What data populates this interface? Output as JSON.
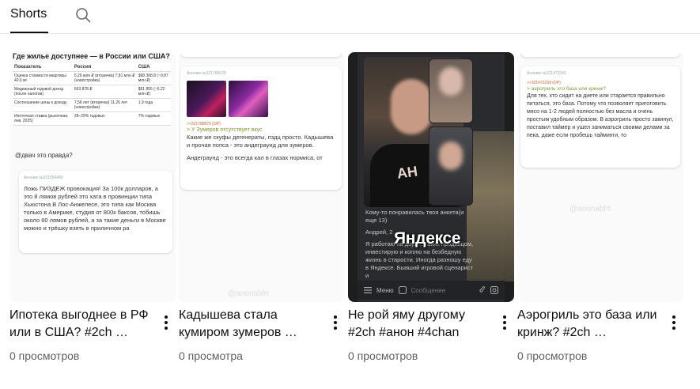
{
  "tabs": {
    "shorts_label": "Shorts"
  },
  "videos": [
    {
      "title": "Ипотека выгоднее в РФ или в США? #2ch …",
      "views": "0 просмотров",
      "thumb": {
        "heading": "Где жилье доступнее — в России или США?",
        "table_head": [
          "Показатель",
          "Россия",
          "США"
        ],
        "rows": [
          [
            "Оценка стоимости квартиры 40,6 м²",
            "5,26 млн ₽ (вторичка) 7,81 млн ₽ (новостройка)",
            "$98 368,8 (~9,87 млн ₽)"
          ],
          [
            "Медианный годовой доход (после налогов)",
            "693 878 ₽",
            "$51 855 (~5,22 млн ₽)"
          ],
          [
            "Соотношение цены к доходу",
            "7,58 лет (вторичка) 11,26 лет (новостройка)",
            "1,9 года"
          ],
          [
            "Ипотечная ставка (рыночная, янв. 2025)",
            "28–29% годовых",
            "7% годовых"
          ]
        ],
        "question": "@двач это правда?",
        "anon": "Аноним   №321856489",
        "post": "Ложь ПИЗДЕЖ провокация! За 100к долларов, а это 8 лямов рублей это хата в провинции типа Хьюстона В Лос-Анжелесе, это типа как Москва только в Америке, студия от 800к баксов, тобишь около 60 лямов рублей, а за такие деньги в Москве можно и трёшку взять в приличном ра"
      }
    },
    {
      "title": "Кадышева стала кумиром зумеров …",
      "views": "0 просмотра",
      "thumb": {
        "anon": "Аноним   №321789028",
        "reply_link": ">>321788870 (OP)",
        "greentext": "> У Зумеров отсутствует вкус",
        "post1": "Какие же скуфы дегенераты, пздц просто. Кадышева и прочая попса - это андеграунд для зумеров.",
        "post2": "Андеграунд - это всегда кал в глазах нормиса, от",
        "watermark": "@anonablrt"
      }
    },
    {
      "title": "Не рой яму другому #2ch #анон #4chan",
      "views": "0 просмотров",
      "thumb": {
        "shirt_text": "AH",
        "chat1": "Кому-то понравилась твоя анкета(и еще 13)",
        "chat2": "Андрей, 2",
        "caption": "Яндексе",
        "chat3": "Я работаю на двух… таких продавцом, инвестирую и коплю на безбедную жизнь в старости. Иногда разношу еду в Яндексе. Бывший игровой сценарист и",
        "menu": "Меню",
        "message": "Сообщение"
      }
    },
    {
      "title": "Аэрогриль это база или кринж? #2ch …",
      "views": "0 просмотров",
      "thumb": {
        "anon": "Аноним   №321473243",
        "reply_link": ">>321472239 (OP)",
        "greentext": "> аэрогриль это база или кринж?",
        "post": "Для тех, кто сидит на диете или старается правильно питаться, это база. Потому что позволяет приготовить мясо на 1-2 людей полностью без масла и очень простым удобным образом. В аэрогриль просто закинул, поставил таймер и ушел заниматься своими делами за пека, даже если пробешь тайминги, то",
        "watermark": "@anonablrt"
      }
    }
  ],
  "colors": {
    "text_primary": "#0f0f0f",
    "text_secondary": "#606060",
    "divider": "#e5e5e5",
    "greentext": "#7a9a30",
    "reply_link": "#d06030"
  }
}
